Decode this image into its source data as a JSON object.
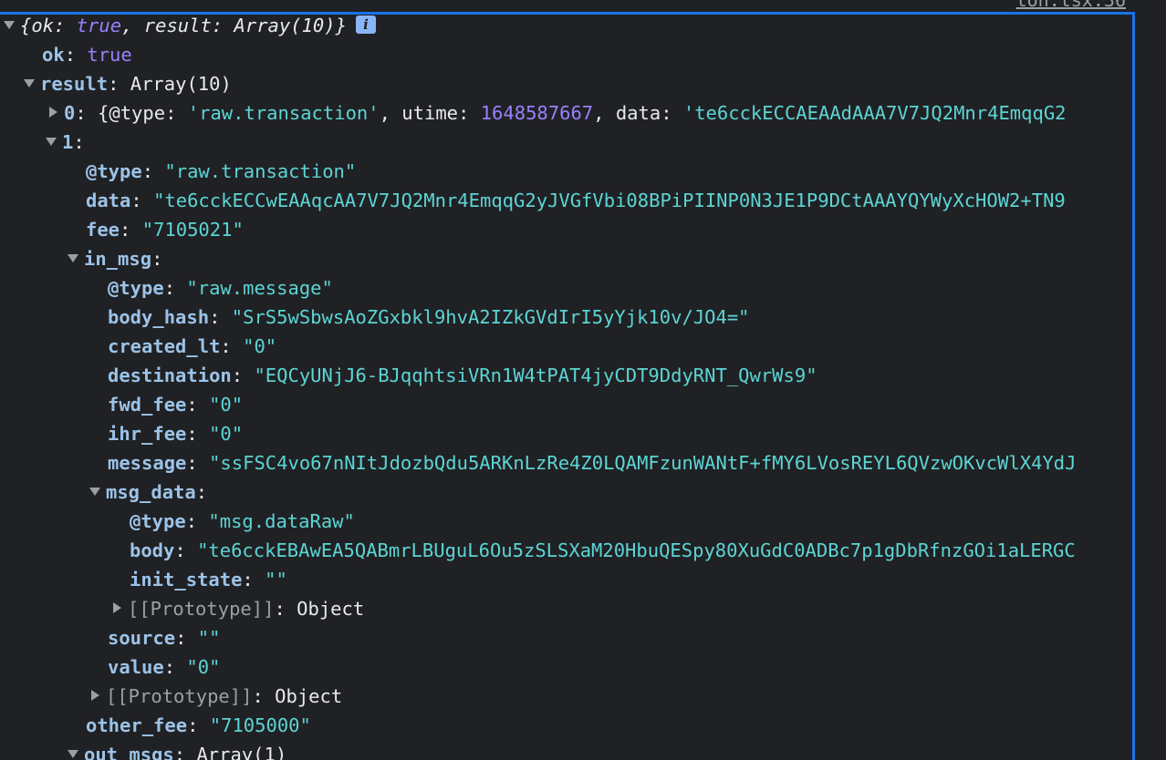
{
  "source_link": "ton.tsx:36",
  "console": {
    "summary": {
      "open": "{",
      "ok_key": "ok",
      "ok_val": "true",
      "result_key": "result",
      "result_val": "Array(10)",
      "close": "}",
      "info": "i"
    },
    "ok": {
      "key": "ok",
      "value": "true"
    },
    "result": {
      "key": "result",
      "value": "Array(10)"
    },
    "item0": {
      "index": "0",
      "type_key": "@type",
      "type_val": "'raw.transaction'",
      "utime_key": "utime",
      "utime_val": "1648587667",
      "data_key": "data",
      "data_val": "'te6cckECCAEAAdAAA7V7JQ2Mnr4EmqqG2"
    },
    "item1": {
      "index": "1",
      "type": {
        "key": "@type",
        "value": "\"raw.transaction\""
      },
      "data": {
        "key": "data",
        "value": "\"te6cckECCwEAAqcAA7V7JQ2Mnr4EmqqG2yJVGfVbi08BPiPIINP0N3JE1P9DCtAAAYQYWyXcHOW2+TN9"
      },
      "fee": {
        "key": "fee",
        "value": "\"7105021\""
      },
      "in_msg": {
        "key": "in_msg",
        "type": {
          "key": "@type",
          "value": "\"raw.message\""
        },
        "body_hash": {
          "key": "body_hash",
          "value": "\"SrS5wSbwsAoZGxbkl9hvA2IZkGVdIrI5yYjk10v/JO4=\""
        },
        "created_lt": {
          "key": "created_lt",
          "value": "\"0\""
        },
        "destination": {
          "key": "destination",
          "value": "\"EQCyUNjJ6-BJqqhtsiVRn1W4tPAT4jyCDT9DdyRNT_QwrWs9\""
        },
        "fwd_fee": {
          "key": "fwd_fee",
          "value": "\"0\""
        },
        "ihr_fee": {
          "key": "ihr_fee",
          "value": "\"0\""
        },
        "message": {
          "key": "message",
          "value": "\"ssFSC4vo67nNItJdozbQdu5ARKnLzRe4Z0LQAMFzunWANtF+fMY6LVosREYL6QVzwOKvcWlX4YdJ"
        },
        "msg_data": {
          "key": "msg_data",
          "type": {
            "key": "@type",
            "value": "\"msg.dataRaw\""
          },
          "body": {
            "key": "body",
            "value": "\"te6cckEBAwEA5QABmrLBUguL6Ou5zSLSXaM20HbuQESpy80XuGdC0ADBc7p1gDbRfnzGOi1aLERGC"
          },
          "init_state": {
            "key": "init_state",
            "value": "\"\""
          },
          "prototype": {
            "key": "[[Prototype]]",
            "value": "Object"
          }
        },
        "source": {
          "key": "source",
          "value": "\"\""
        },
        "value": {
          "key": "value",
          "value": "\"0\""
        },
        "prototype": {
          "key": "[[Prototype]]",
          "value": "Object"
        }
      },
      "other_fee": {
        "key": "other_fee",
        "value": "\"7105000\""
      },
      "out_msgs": {
        "key": "out_msgs",
        "value": "Array(1)"
      }
    },
    "colon": ":",
    "comma": ",",
    "colon_space": ": "
  },
  "colors": {
    "background": "#202124",
    "key": "#9cc3e8",
    "string": "#5cd5d5",
    "number": "#9980ff",
    "selection_border": "#1a73e8"
  },
  "icons": {
    "expanded": "triangle-down-icon",
    "collapsed": "triangle-right-icon",
    "info": "info-icon"
  }
}
